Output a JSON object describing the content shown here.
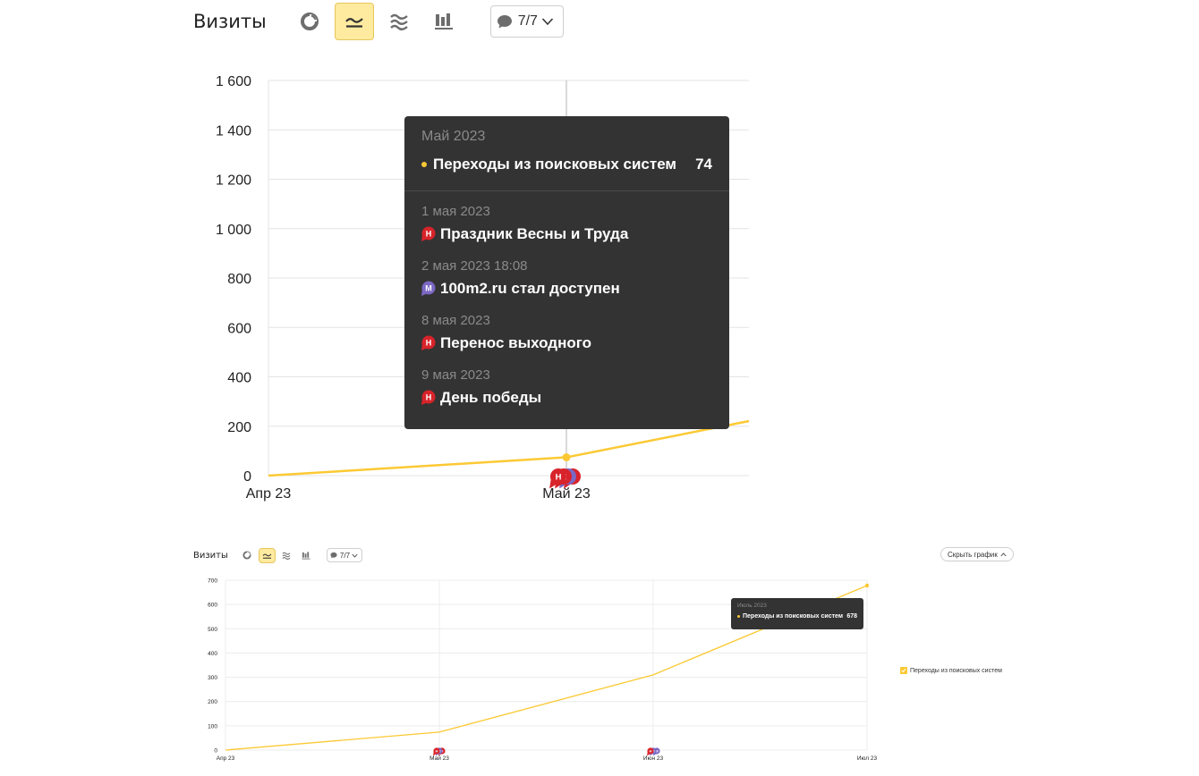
{
  "toolbar": {
    "title": "Визиты",
    "counter_label": "7/7",
    "hide_chart_label": "Скрыть график"
  },
  "icons": [
    "pie-chart-icon",
    "line-chart-icon",
    "area-chart-icon",
    "bar-chart-icon",
    "comment-icon",
    "chevron-down-icon",
    "chevron-up-icon",
    "holiday-marker-icon",
    "manual-note-marker-icon"
  ],
  "colors": {
    "series": "#fcc934",
    "holiday_marker": "#d8232a",
    "note_marker": "#7b68c4",
    "tooltip_bg": "#333333",
    "active_button": "#ffeba0"
  },
  "tooltip_large": {
    "date": "Май 2023",
    "series_label": "Переходы из поисковых систем",
    "value": "74",
    "events": [
      {
        "date": "1 мая 2023",
        "title": "Праздник Весны и Труда",
        "marker": "Н",
        "kind": "holiday"
      },
      {
        "date": "2 мая 2023 18:08",
        "title": "100m2.ru стал доступен",
        "marker": "М",
        "kind": "note"
      },
      {
        "date": "8 мая 2023",
        "title": "Перенос выходного",
        "marker": "Н",
        "kind": "holiday"
      },
      {
        "date": "9 мая 2023",
        "title": "День победы",
        "marker": "Н",
        "kind": "holiday"
      }
    ]
  },
  "tooltip_small": {
    "date": "Июль 2023",
    "series_label": "Переходы из поисковых систем",
    "value": "678"
  },
  "legend": {
    "label": "Переходы из поисковых систем"
  },
  "chart_data": [
    {
      "type": "line",
      "title": "",
      "x": [
        "Апр 23",
        "Май 23"
      ],
      "x_tick_labels": [
        "Апр 23",
        "Май 23"
      ],
      "series": [
        {
          "values": [
            0,
            74
          ]
        }
      ],
      "y_ticks": [
        0,
        200,
        400,
        600,
        800,
        1000,
        1200,
        1400,
        1600
      ],
      "y_tick_labels": [
        "0",
        "200",
        "400",
        "600",
        "800",
        "1 000",
        "1 200",
        "1 400",
        "1 600"
      ],
      "ylim": [
        0,
        1600
      ],
      "grid": true,
      "note": "line continues beyond the visible right edge"
    },
    {
      "type": "line",
      "title": "",
      "x": [
        "Апр 23",
        "Май 23",
        "Июн 23",
        "Июл 23"
      ],
      "x_tick_labels": [
        "Апр 23",
        "Май 23",
        "Июн 23",
        "Июл 23"
      ],
      "series": [
        {
          "name": "Переходы из поисковых систем",
          "values": [
            0,
            74,
            310,
            678
          ]
        }
      ],
      "y_ticks": [
        0,
        100,
        200,
        300,
        400,
        500,
        600,
        700
      ],
      "y_tick_labels": [
        "0",
        "100",
        "200",
        "300",
        "400",
        "500",
        "600",
        "700"
      ],
      "ylim": [
        0,
        700
      ],
      "grid": true,
      "legend_position": "right"
    }
  ]
}
